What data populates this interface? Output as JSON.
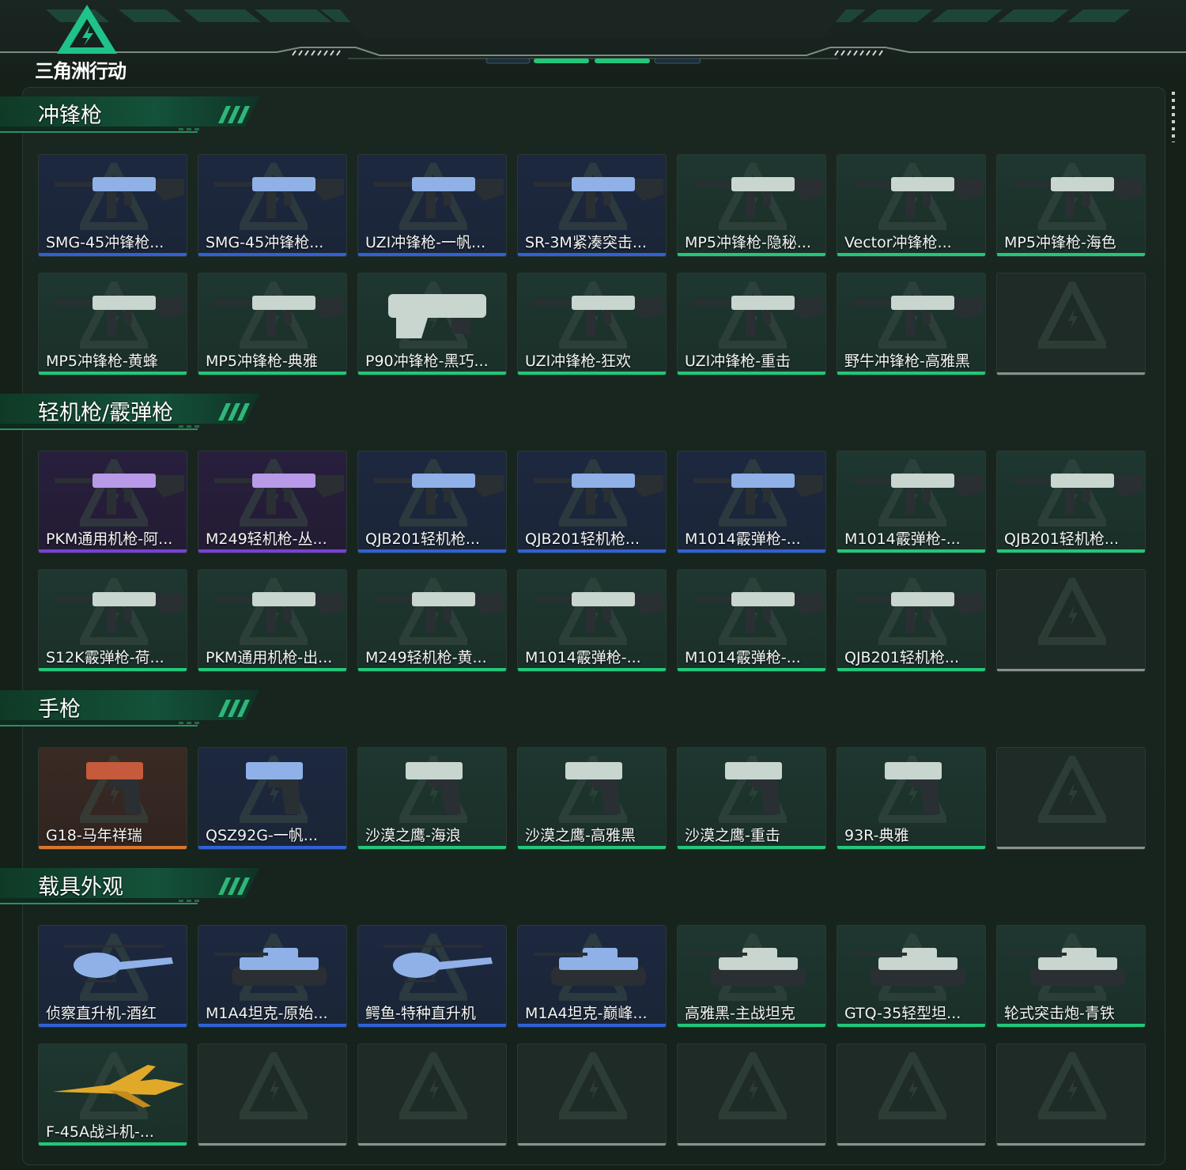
{
  "app": {
    "logo_text": "三角洲行动"
  },
  "colors": {
    "green": "#22c77a",
    "blue": "#2f62d6",
    "purple": "#7a3fd8",
    "orange": "#d8752e",
    "empty": "#8b8f8d"
  },
  "sections": [
    {
      "title": "冲锋枪",
      "items": [
        {
          "name": "SMG-45冲锋枪...",
          "quality": "blue",
          "icon": "smg-icon"
        },
        {
          "name": "SMG-45冲锋枪...",
          "quality": "blue",
          "icon": "smg-icon"
        },
        {
          "name": "UZI冲锋枪-一帆...",
          "quality": "blue",
          "icon": "uzi-icon"
        },
        {
          "name": "SR-3M紧凑突击...",
          "quality": "blue",
          "icon": "smg-icon"
        },
        {
          "name": "MP5冲锋枪-隐秘...",
          "quality": "green",
          "icon": "smg-icon"
        },
        {
          "name": "Vector冲锋枪...",
          "quality": "green",
          "icon": "smg-icon"
        },
        {
          "name": "MP5冲锋枪-海色",
          "quality": "green",
          "icon": "smg-icon"
        },
        {
          "name": "MP5冲锋枪-黄蜂",
          "quality": "green",
          "icon": "smg-icon"
        },
        {
          "name": "MP5冲锋枪-典雅",
          "quality": "green",
          "icon": "smg-icon"
        },
        {
          "name": "P90冲锋枪-黑巧...",
          "quality": "green",
          "icon": "p90-icon"
        },
        {
          "name": "UZI冲锋枪-狂欢",
          "quality": "green",
          "icon": "uzi-icon"
        },
        {
          "name": "UZI冲锋枪-重击",
          "quality": "green",
          "icon": "uzi-icon"
        },
        {
          "name": "野牛冲锋枪-高雅黑",
          "quality": "green",
          "icon": "smg-icon"
        },
        {
          "name": "",
          "quality": "empty",
          "icon": ""
        }
      ]
    },
    {
      "title": "轻机枪/霰弹枪",
      "items": [
        {
          "name": "PKM通用机枪-阿...",
          "quality": "purple",
          "icon": "lmg-icon"
        },
        {
          "name": "M249轻机枪-丛...",
          "quality": "purple",
          "icon": "lmg-icon"
        },
        {
          "name": "QJB201轻机枪...",
          "quality": "blue",
          "icon": "lmg-icon"
        },
        {
          "name": "QJB201轻机枪...",
          "quality": "blue",
          "icon": "lmg-icon"
        },
        {
          "name": "M1014霰弹枪-...",
          "quality": "blue",
          "icon": "shotgun-icon"
        },
        {
          "name": "M1014霰弹枪-...",
          "quality": "green",
          "icon": "shotgun-icon"
        },
        {
          "name": "QJB201轻机枪...",
          "quality": "green",
          "icon": "lmg-icon"
        },
        {
          "name": "S12K霰弹枪-荷...",
          "quality": "green",
          "icon": "shotgun-icon"
        },
        {
          "name": "PKM通用机枪-出...",
          "quality": "green",
          "icon": "lmg-icon"
        },
        {
          "name": "M249轻机枪-黄...",
          "quality": "green",
          "icon": "lmg-icon"
        },
        {
          "name": "M1014霰弹枪-...",
          "quality": "green",
          "icon": "shotgun-icon"
        },
        {
          "name": "M1014霰弹枪-...",
          "quality": "green",
          "icon": "shotgun-icon"
        },
        {
          "name": "QJB201轻机枪...",
          "quality": "green",
          "icon": "lmg-icon"
        },
        {
          "name": "",
          "quality": "empty",
          "icon": ""
        }
      ]
    },
    {
      "title": "手枪",
      "items": [
        {
          "name": "G18-马年祥瑞",
          "quality": "orange",
          "icon": "pistol-icon"
        },
        {
          "name": "QSZ92G-一帆...",
          "quality": "blue",
          "icon": "pistol-icon"
        },
        {
          "name": "沙漠之鹰-海浪",
          "quality": "green",
          "icon": "pistol-icon"
        },
        {
          "name": "沙漠之鹰-高雅黑",
          "quality": "green",
          "icon": "pistol-icon"
        },
        {
          "name": "沙漠之鹰-重击",
          "quality": "green",
          "icon": "pistol-icon"
        },
        {
          "name": "93R-典雅",
          "quality": "green",
          "icon": "pistol-icon"
        },
        {
          "name": "",
          "quality": "empty",
          "icon": ""
        }
      ]
    },
    {
      "title": "载具外观",
      "items": [
        {
          "name": "侦察直升机-酒红",
          "quality": "blue",
          "icon": "helicopter-icon"
        },
        {
          "name": "M1A4坦克-原始...",
          "quality": "blue",
          "icon": "tank-icon"
        },
        {
          "name": "鳄鱼-特种直升机",
          "quality": "blue",
          "icon": "helicopter-icon"
        },
        {
          "name": "M1A4坦克-巅峰...",
          "quality": "blue",
          "icon": "tank-icon"
        },
        {
          "name": "高雅黑-主战坦克",
          "quality": "green",
          "icon": "tank-icon"
        },
        {
          "name": "GTQ-35轻型坦...",
          "quality": "green",
          "icon": "tank-icon"
        },
        {
          "name": "轮式突击炮-青铁",
          "quality": "green",
          "icon": "armored-car-icon"
        },
        {
          "name": "F-45A战斗机-...",
          "quality": "green",
          "icon": "jet-icon"
        },
        {
          "name": "",
          "quality": "empty",
          "icon": ""
        },
        {
          "name": "",
          "quality": "empty",
          "icon": ""
        },
        {
          "name": "",
          "quality": "empty",
          "icon": ""
        },
        {
          "name": "",
          "quality": "empty",
          "icon": ""
        },
        {
          "name": "",
          "quality": "empty",
          "icon": ""
        },
        {
          "name": "",
          "quality": "empty",
          "icon": ""
        }
      ]
    }
  ]
}
